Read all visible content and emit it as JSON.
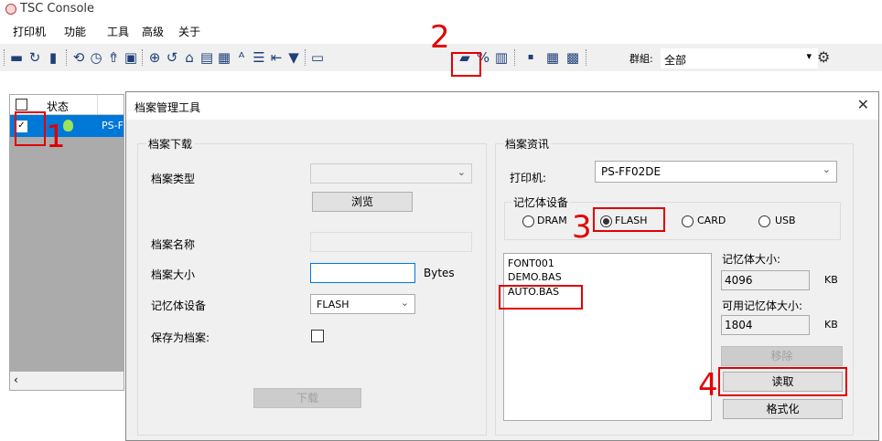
{
  "app": {
    "title": "TSC Console"
  },
  "menu": [
    "打印机",
    "功能",
    "工具",
    "高级",
    "关于"
  ],
  "toolbar": {
    "group_label": "群組:",
    "group_value": "全部"
  },
  "grid": {
    "col_status": "状态",
    "row_name": "PS-F"
  },
  "dialog": {
    "title": "档案管理工具",
    "download": {
      "group": "档案下载",
      "file_type_label": "档案类型",
      "file_type_value": "",
      "browse": "浏览",
      "file_name_label": "档案名称",
      "file_name_value": "",
      "file_size_label": "档案大小",
      "file_size_value": "",
      "bytes": "Bytes",
      "memory_label": "记忆体设备",
      "memory_value": "FLASH",
      "save_label": "保存为档案:",
      "download_button": "下载"
    },
    "info": {
      "group": "档案资讯",
      "printer_label": "打印机:",
      "printer_value": "PS-FF02DE",
      "memory_group": "记忆体设备",
      "radios": [
        "DRAM",
        "FLASH",
        "CARD",
        "USB"
      ],
      "selected": "FLASH",
      "files": [
        "FONT001",
        "DEMO.BAS",
        "AUTO.BAS"
      ],
      "mem_size_label": "记忆体大小:",
      "mem_size_value": "4096",
      "kb": "KB",
      "avail_label": "可用记忆体大小:",
      "avail_value": "1804",
      "remove": "移除",
      "read": "读取",
      "format": "格式化"
    }
  },
  "annotations": [
    "1",
    "2",
    "3",
    "4"
  ],
  "colors": {
    "accent": "#0078d7",
    "annotation": "#e00000"
  }
}
